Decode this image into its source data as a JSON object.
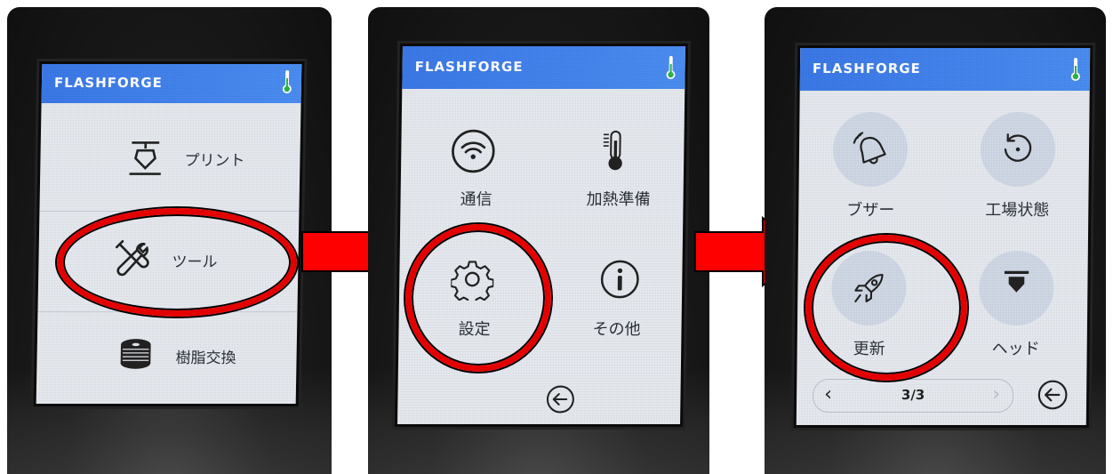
{
  "brand": "FLASHFORGE",
  "panel1": {
    "items": [
      {
        "label": "プリント",
        "icon": "print-nozzle-icon"
      },
      {
        "label": "ツール",
        "icon": "tools-icon"
      },
      {
        "label": "樹脂交換",
        "icon": "filament-spool-icon"
      }
    ]
  },
  "panel2": {
    "items": [
      {
        "label": "通信",
        "icon": "wifi-icon"
      },
      {
        "label": "加熱準備",
        "icon": "thermometer-icon"
      },
      {
        "label": "設定",
        "icon": "gear-icon"
      },
      {
        "label": "その他",
        "icon": "info-icon"
      }
    ]
  },
  "panel3": {
    "items": [
      {
        "label": "ブザー",
        "icon": "bell-icon"
      },
      {
        "label": "工場状態",
        "icon": "reset-icon"
      },
      {
        "label": "更新",
        "icon": "rocket-icon"
      },
      {
        "label": "ヘッド",
        "icon": "nozzle-head-icon"
      }
    ],
    "page": "3/3"
  },
  "colors": {
    "titlebar": "#4a8cf0",
    "highlight": "#e30000",
    "arrow": "#ff0000"
  }
}
